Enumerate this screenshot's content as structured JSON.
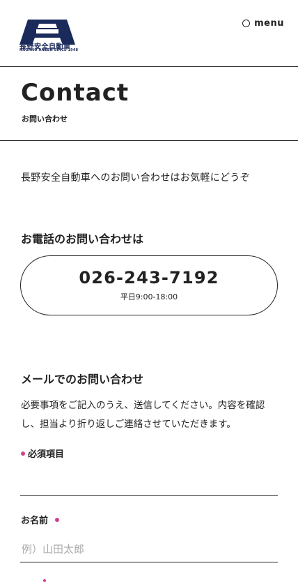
{
  "header": {
    "logo_jp": "長野安全自動車",
    "logo_en": "NAGANO ANZEN SINCE 1948",
    "menu_label": "menu"
  },
  "page": {
    "title": "Contact",
    "subtitle": "お問い合わせ"
  },
  "intro": "長野安全自動車へのお問い合わせはお気軽にどうぞ",
  "phone": {
    "heading": "お電話のお問い合わせは",
    "number": "026-243-7192",
    "hours": "平日9:00-18:00"
  },
  "mail": {
    "heading": "メールでのお問い合わせ",
    "description": "必要事項をご記入のうえ、送信してください。内容を確認し、担当より折り返しご連絡させていただきます。",
    "required_note": "必須項目"
  },
  "form": {
    "name_label": "お名前",
    "name_placeholder": "例）山田太郎"
  },
  "colors": {
    "brand_navy": "#1a2a5a",
    "required_pink": "#d0408c"
  }
}
